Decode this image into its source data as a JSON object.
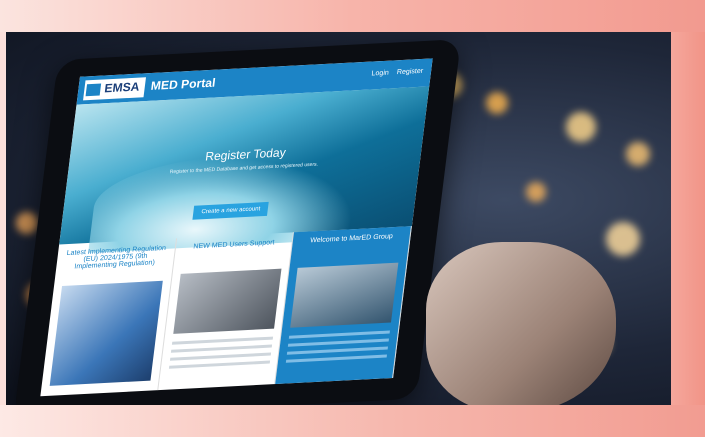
{
  "portal": {
    "logo": "EMSA",
    "title": "MED Portal",
    "nav": [
      "Login",
      "Register"
    ],
    "hero_title": "Register Today",
    "hero_subtitle": "Register to the MED Database and get access to registered users.",
    "cta_label": "Create a new account"
  },
  "columns": [
    {
      "title": "Latest Implementing Regulation (EU) 2024/1975 (9th Implementing Regulation)"
    },
    {
      "title": "NEW MED Users Support"
    },
    {
      "title": "Welcome to MarED Group"
    }
  ],
  "colors": {
    "accent": "#1c84c6",
    "frame": "#f39b90"
  }
}
